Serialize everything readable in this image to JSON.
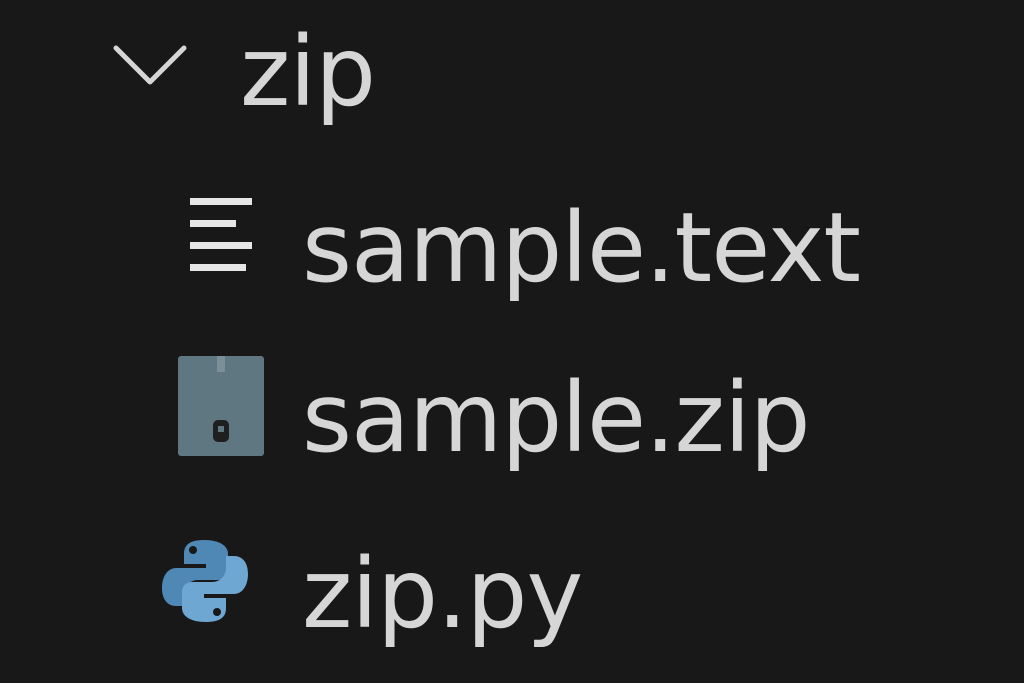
{
  "explorer": {
    "folder": {
      "name": "zip",
      "expanded": true,
      "icon": "chevron-down-icon"
    },
    "files": [
      {
        "name": "sample.text",
        "icon": "text-file-icon"
      },
      {
        "name": "sample.zip",
        "icon": "zip-file-icon"
      },
      {
        "name": "zip.py",
        "icon": "python-file-icon"
      }
    ]
  },
  "colors": {
    "background": "#181818",
    "text": "#d6d6d6",
    "zip_icon": "#5f7780",
    "python_blue": "#4f88b5",
    "python_light": "#6ea7d1"
  }
}
